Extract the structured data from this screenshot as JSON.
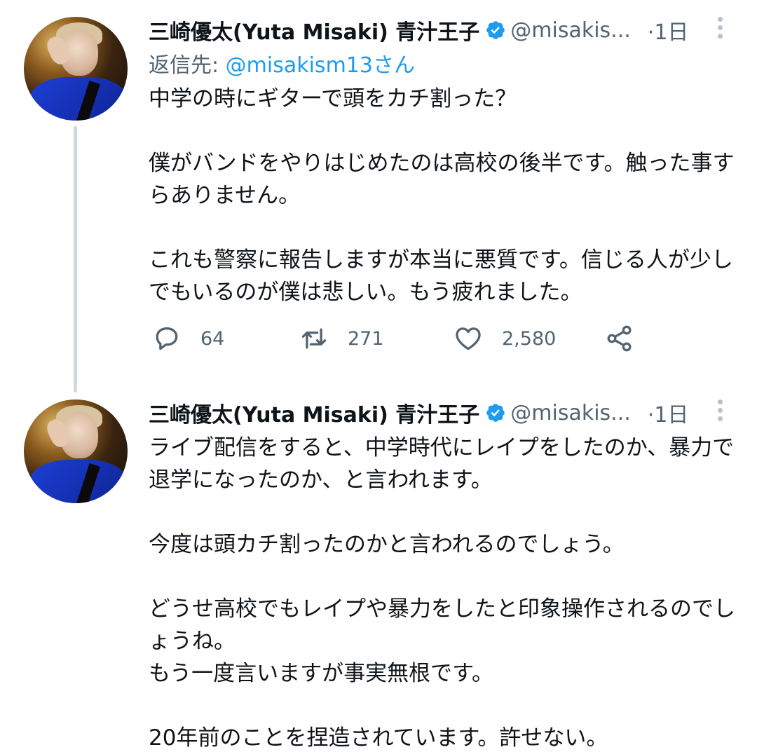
{
  "tweets": [
    {
      "display_name": "三崎優太(Yuta Misaki) 青汁王子",
      "handle": "@misakis...",
      "time": "·1日",
      "reply_to_label": "返信先: ",
      "reply_to_mention": "@misakism13さん",
      "text": "中学の時にギターで頭をカチ割った？\n\n僕がバンドをやりはじめたのは高校の後半です。触った事すらありません。\n\nこれも警察に報告しますが本当に悪質です。信じる人が少しでもいるのが僕は悲しい。もう疲れました。",
      "replies": "64",
      "retweets": "271",
      "likes": "2,580"
    },
    {
      "display_name": "三崎優太(Yuta Misaki) 青汁王子",
      "handle": "@misakis...",
      "time": "·1日",
      "text": "ライブ配信をすると、中学時代にレイプをしたのか、暴力で退学になったのか、と言われます。\n\n今度は頭カチ割ったのかと言われるのでしょう。\n\nどうせ高校でもレイプや暴力をしたと印象操作されるのでしょうね。\nもう一度言いますが事実無根です。\n\n20年前のことを捏造されています。許せない。"
    }
  ],
  "colors": {
    "accent": "#1d9bf0",
    "secondary_text": "#536471",
    "thread_line": "#cfd9de",
    "verified": "#1d9bf0"
  },
  "icons": {
    "reply": "reply-icon",
    "retweet": "retweet-icon",
    "like": "heart-icon",
    "share": "share-icon",
    "more": "more-vertical-icon",
    "verified": "verified-badge-icon"
  }
}
